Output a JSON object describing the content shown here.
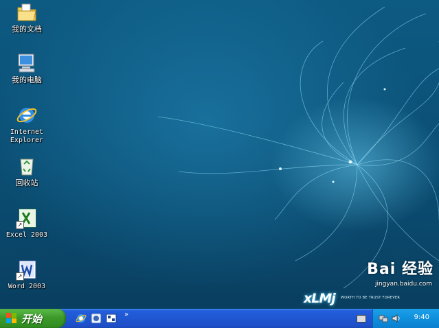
{
  "desktop": {
    "icons": [
      {
        "label": "我的文档"
      },
      {
        "label": "我的电脑"
      },
      {
        "label": "Internet\nExplorer"
      },
      {
        "label": "回收站"
      },
      {
        "label": "Excel 2003"
      },
      {
        "label": "Word 2003"
      }
    ],
    "wallpaper_logo": "xLMj",
    "wallpaper_tagline": "WORTH TO BE TRUST FOREVER"
  },
  "watermark": {
    "brand": "Bai 经验",
    "url": "jingyan.baidu.com"
  },
  "taskbar": {
    "start_label": "开始",
    "quicklaunch_more": "»",
    "clock": "9:40"
  },
  "colors": {
    "taskbar": "#245edb",
    "start": "#3c9a2a",
    "tray": "#0f8fdd",
    "desktop": "#0c4f72"
  }
}
